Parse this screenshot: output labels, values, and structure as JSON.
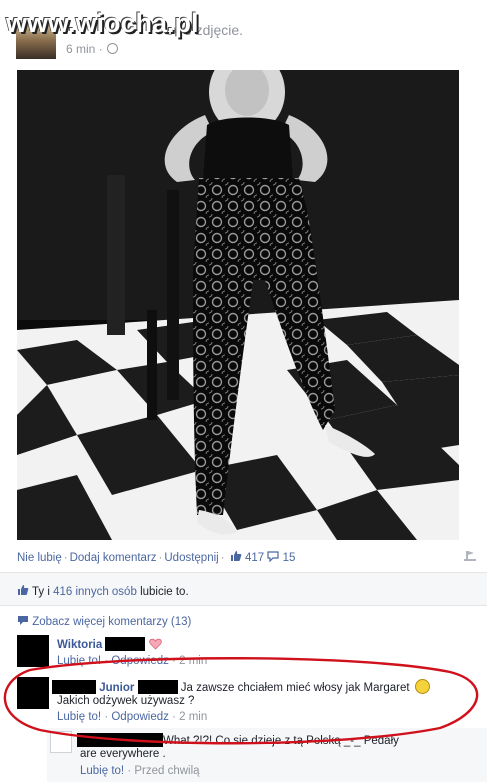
{
  "watermark": "www.wiocha.pl",
  "post": {
    "header_text": "owe zdjęcie.",
    "time": "6 min ·"
  },
  "actions": {
    "like": "Nie lubię",
    "comment": "Dodaj komentarz",
    "share": "Udostępnij",
    "like_count": "417",
    "comment_count": "15"
  },
  "likes": {
    "you": "Ty i",
    "others": "416 innych osób",
    "suffix": "lubicie to."
  },
  "more_comments": "Zobacz więcej komentarzy (13)",
  "comments": [
    {
      "name": "Wiktoria",
      "like_label": "Lubię to!",
      "reply_label": "Odpowiedz",
      "time": "2 min"
    },
    {
      "name": "Junior",
      "text_line1": "Ja zawsze chciałem mieć włosy jak Margaret",
      "text_line2": "Jakich odżywek używasz ?",
      "like_label": "Lubię to!",
      "reply_label": "Odpowiedz",
      "time": "2 min"
    }
  ],
  "reply": {
    "text_line1": "What ?!?! Co sie dzieje z tą Polską _-_ Pedały",
    "text_line2": "are everywhere .",
    "like_label": "Lubię to!",
    "time": "Przed chwilą"
  },
  "colors": {
    "link": "#4b67a1",
    "name": "#3b5998",
    "meta": "#90949c",
    "oval": "#d0101a"
  }
}
